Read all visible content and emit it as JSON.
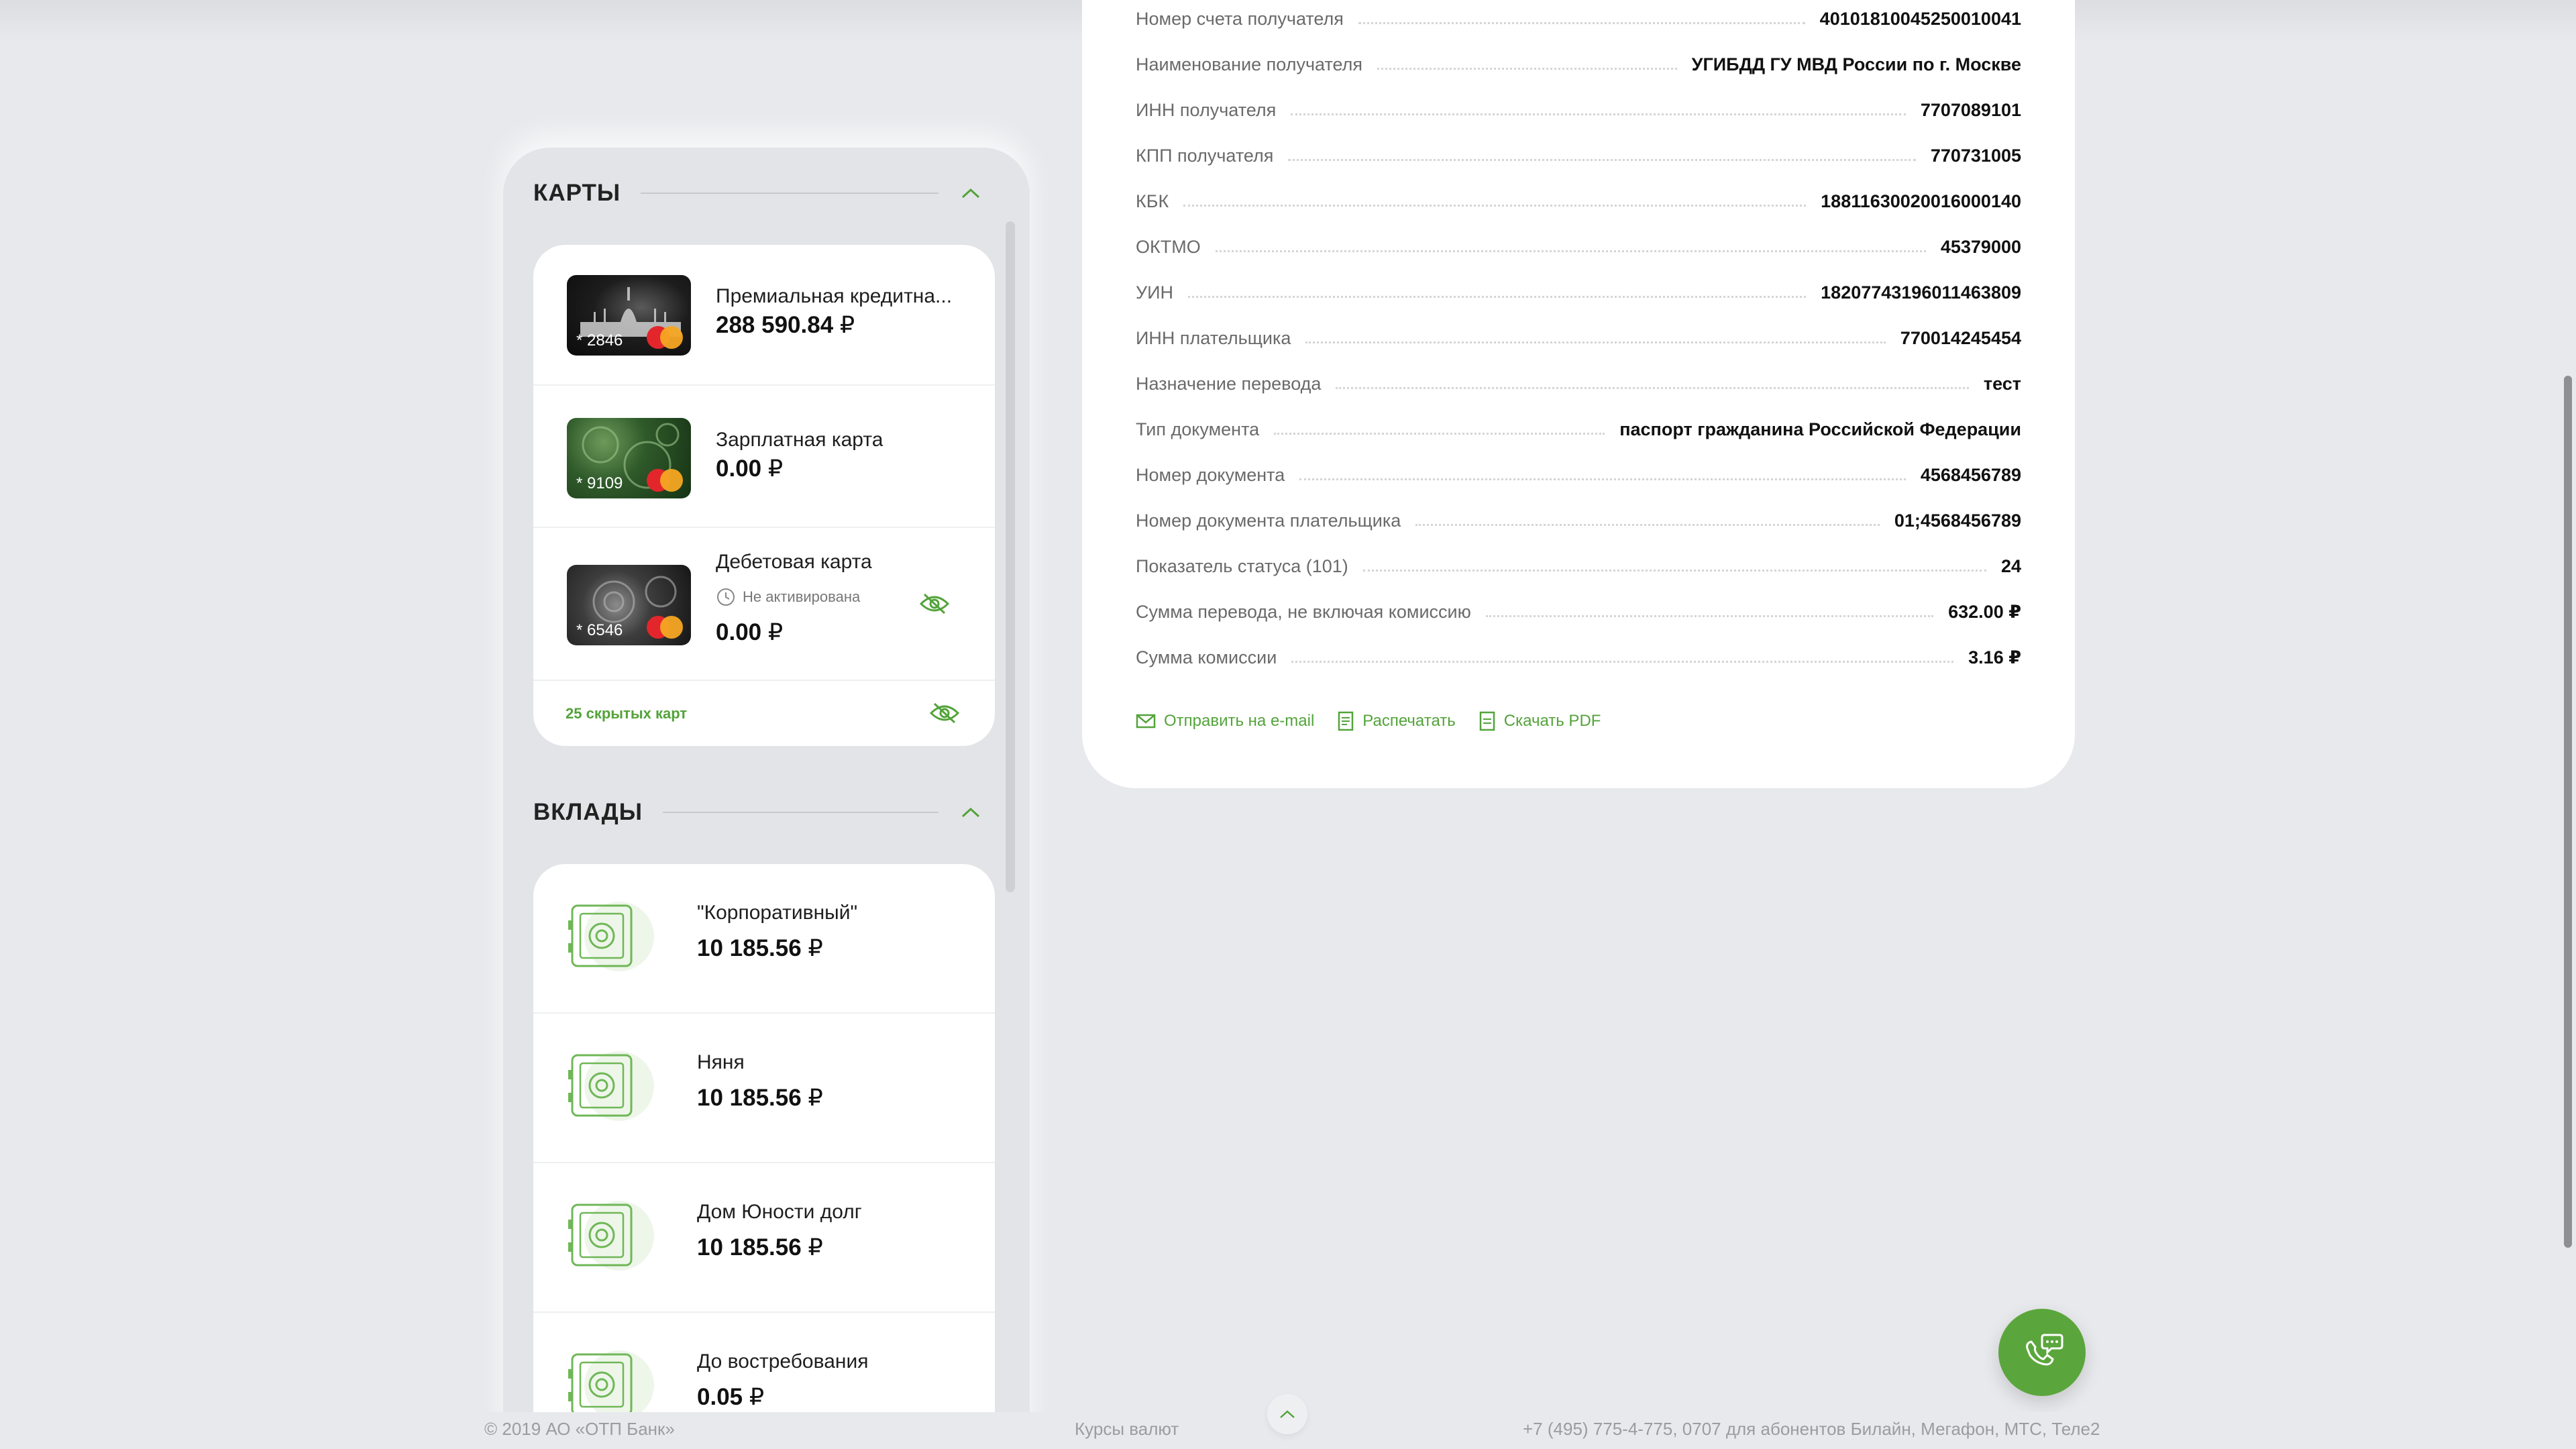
{
  "sidebar": {
    "cards_section": {
      "title": "КАРТЫ",
      "cards": [
        {
          "name": "Премиальная кредитна...",
          "masked": "* 2846",
          "amount": "288 590.84",
          "currency": "₽",
          "status": ""
        },
        {
          "name": "Зарплатная карта",
          "masked": "* 9109",
          "amount": "0.00",
          "currency": "₽",
          "status": ""
        },
        {
          "name": "Дебетовая карта",
          "masked": "* 6546",
          "amount": "0.00",
          "currency": "₽",
          "status": "Не активирована"
        }
      ],
      "hidden_cards_label": "25 скрытых карт"
    },
    "deposits_section": {
      "title": "ВКЛАДЫ",
      "deposits": [
        {
          "name": "\"Корпоративный\"",
          "amount": "10 185.56",
          "currency": "₽"
        },
        {
          "name": "Няня",
          "amount": "10 185.56",
          "currency": "₽"
        },
        {
          "name": "Дом Юности долг",
          "amount": "10 185.56",
          "currency": "₽"
        },
        {
          "name": "До востребования",
          "amount": "0.05",
          "currency": "₽"
        }
      ]
    }
  },
  "receipt": {
    "rows": [
      {
        "label": "Номер счета получателя",
        "value": "40101810045250010041"
      },
      {
        "label": "Наименование получателя",
        "value": "УГИБДД ГУ МВД России по г. Москве"
      },
      {
        "label": "ИНН получателя",
        "value": "7707089101"
      },
      {
        "label": "КПП получателя",
        "value": "770731005"
      },
      {
        "label": "КБК",
        "value": "18811630020016000140"
      },
      {
        "label": "ОКТМО",
        "value": "45379000"
      },
      {
        "label": "УИН",
        "value": "18207743196011463809"
      },
      {
        "label": "ИНН плательщика",
        "value": "770014245454"
      },
      {
        "label": "Назначение перевода",
        "value": "тест"
      },
      {
        "label": "Тип документа",
        "value": "паспорт гражданина Российской Федерации"
      },
      {
        "label": "Номер документа",
        "value": "4568456789"
      },
      {
        "label": "Номер документа плательщика",
        "value": "01;4568456789"
      },
      {
        "label": "Показатель статуса (101)",
        "value": "24"
      },
      {
        "label": "Сумма перевода, не включая комиссию",
        "value": "632.00 ₽"
      },
      {
        "label": "Сумма комиссии",
        "value": "3.16 ₽"
      }
    ],
    "actions": {
      "email": "Отправить на e-mail",
      "print": "Распечатать",
      "pdf": "Скачать PDF"
    }
  },
  "footer": {
    "copyright": "© 2019 АО «ОТП Банк»",
    "rates": "Курсы валют",
    "phones": "+7 (495) 775-4-775,  0707 для абонентов Билайн, Мегафон, МТС, Теле2"
  },
  "colors": {
    "accent": "#53a33a",
    "call_button": "#5aa63c",
    "background": "#e8e9ec"
  }
}
